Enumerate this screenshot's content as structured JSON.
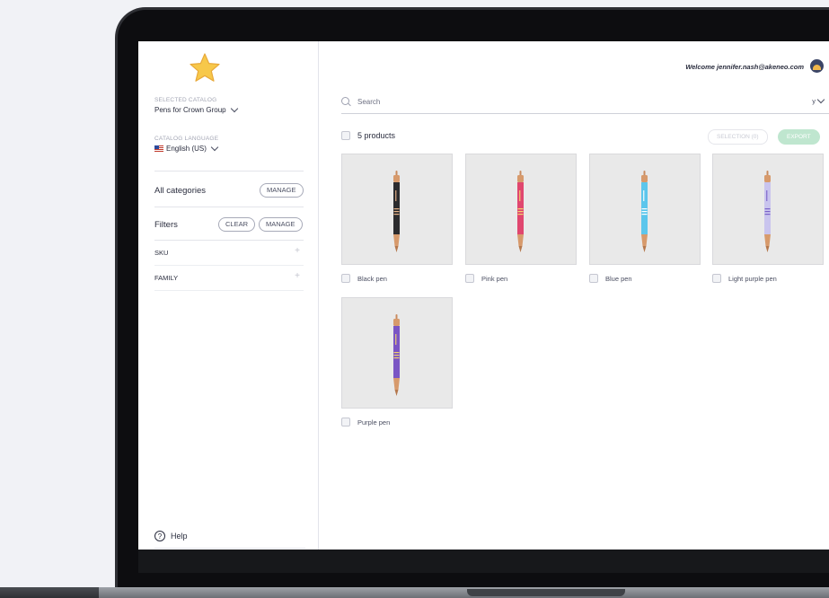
{
  "header": {
    "welcome_text": "Welcome jennifer.nash@akeneo.com"
  },
  "sidebar": {
    "catalog_caption": "SELECTED CATALOG",
    "catalog_value": "Pens for Crown Group",
    "language_caption": "CATALOG LANGUAGE",
    "language_value": "English (US)",
    "categories_label": "All categories",
    "categories_manage": "MANAGE",
    "filters_label": "Filters",
    "filters_clear": "CLEAR",
    "filters_manage": "MANAGE",
    "filters": [
      {
        "label": "SKU"
      },
      {
        "label": "FAMILY"
      }
    ],
    "help_label": "Help"
  },
  "main": {
    "search_placeholder": "Search",
    "sort_value": "y",
    "product_count": "5 products",
    "selection_button": "SELECTION (0)",
    "export_button": "EXPORT",
    "products": [
      {
        "name": "Black pen",
        "color": "#2b2b2e",
        "accent": "#e8b48a"
      },
      {
        "name": "Pink pen",
        "color": "#e0476f",
        "accent": "#f3d36e"
      },
      {
        "name": "Blue pen",
        "color": "#5cc6ec",
        "accent": "#ffffff"
      },
      {
        "name": "Light purple pen",
        "color": "#c9c4ee",
        "accent": "#7a62c8"
      },
      {
        "name": "Purple pen",
        "color": "#7a55c4",
        "accent": "#f3d36e"
      }
    ]
  },
  "colors": {
    "export_green": "#bfe6cf",
    "logo_star": "#f7c84a",
    "text_primary": "#2a2d3e"
  },
  "icons": [
    "star-logo-icon",
    "chevron-down-icon",
    "us-flag-icon",
    "plus-icon",
    "help-icon",
    "search-icon",
    "avatar-icon"
  ]
}
